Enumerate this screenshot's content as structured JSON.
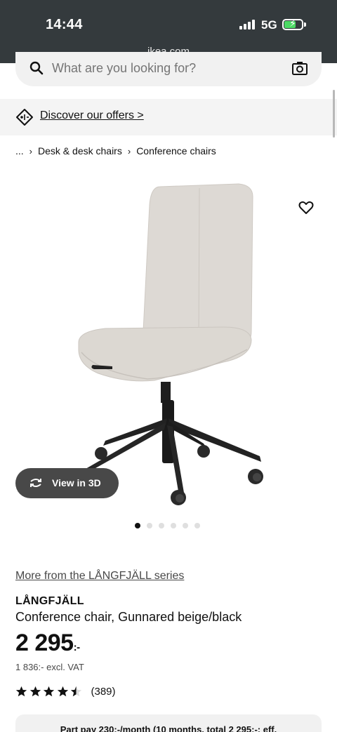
{
  "status_bar": {
    "time": "14:44",
    "network": "5G",
    "url": "ikea.com"
  },
  "search": {
    "placeholder": "What are you looking for?"
  },
  "offers": {
    "label": "Discover our offers >"
  },
  "breadcrumb": {
    "ellipsis": "...",
    "items": [
      "Desk & desk chairs",
      "Conference chairs"
    ]
  },
  "gallery": {
    "view3d_label": "View in 3D",
    "image_count": 6,
    "active_index": 0
  },
  "product": {
    "series_link": "More from the LÅNGFJÄLL series",
    "name": "LÅNGFJÄLL",
    "description": "Conference chair, Gunnared beige/black",
    "price": "2 295",
    "price_suffix": ":-",
    "excl_vat": "1 836:- excl. VAT",
    "rating": 4.5,
    "review_count": "(389)"
  },
  "part_pay": {
    "text": "Part pay 230:-/month (10 months, total 2 295:-; eff."
  },
  "colors": {
    "status_bar": "#343a3d",
    "chair_fabric": "#ddd9d4",
    "chair_base": "#1f1f1f",
    "button_dark": "#484848"
  },
  "icons": [
    "search-icon",
    "camera-icon",
    "offer-tag-icon",
    "chevron-right-icon",
    "heart-icon",
    "rotate-3d-icon",
    "star-icon"
  ]
}
